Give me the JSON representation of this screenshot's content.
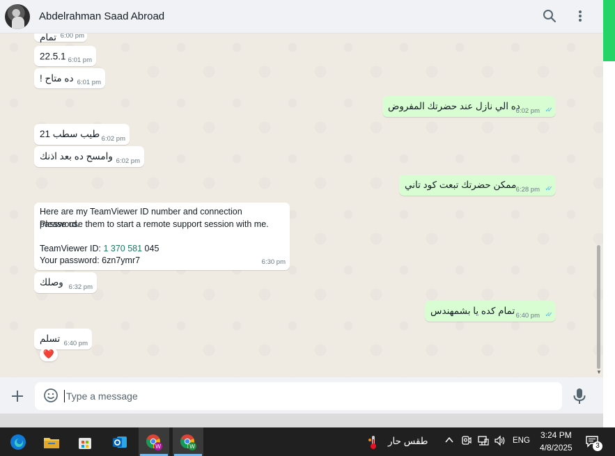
{
  "header": {
    "contact_name": "Abdelrahman Saad Abroad",
    "icons": [
      "search-icon",
      "menu-dots-icon"
    ]
  },
  "messages": [
    {
      "id": "m0",
      "dir": "in",
      "text": "تمام",
      "time": "6:00 pm"
    },
    {
      "id": "m1",
      "dir": "in",
      "text": "22.5.1",
      "time": "6:01 pm"
    },
    {
      "id": "m2",
      "dir": "in",
      "text": "ده متاح !",
      "time": "6:01 pm"
    },
    {
      "id": "m3",
      "dir": "out",
      "text": "ده الي نازل عند حضرتك المفروض",
      "time": "6:02 pm"
    },
    {
      "id": "m4",
      "dir": "in",
      "text": "طيب سطب 21",
      "time": "6:02 pm"
    },
    {
      "id": "m5",
      "dir": "in",
      "text": "وامسح ده بعد اذنك",
      "time": "6:02 pm"
    },
    {
      "id": "m6",
      "dir": "out",
      "text": "ممكن حضرتك تبعت كود تاني",
      "time": "6:28 pm"
    },
    {
      "id": "m8",
      "dir": "in",
      "text": "وصلك",
      "time": "6:32 pm"
    },
    {
      "id": "m9",
      "dir": "out",
      "text": "تمام كده يا بشمهندس",
      "time": "6:40 pm"
    },
    {
      "id": "m10",
      "dir": "in",
      "text": "تسلم",
      "time": "6:40 pm",
      "reaction": "❤️"
    }
  ],
  "teamviewer_msg": {
    "line1": "Here are my TeamViewer ID number and connection password.",
    "line2": "Please use them to start a remote support session with me.",
    "id_label": "TeamViewer ID: ",
    "id_value": "1 370 581",
    "id_suffix": " 045",
    "password_line": "Your password: 6zn7ymr7",
    "time": "6:30 pm"
  },
  "composer": {
    "placeholder": "Type a message"
  },
  "taskbar": {
    "apps": [
      "edge-icon",
      "file-explorer-icon",
      "store-icon",
      "outlook-icon",
      "chrome-profile-icon",
      "chrome-profile-2-icon"
    ],
    "weather": "طقس حار",
    "language": "ENG",
    "time": "3:24 PM",
    "date": "4/8/2025",
    "notification_count": "3"
  },
  "colors": {
    "accent_green": "#25d366",
    "outgoing_bubble": "#d9fdd3",
    "read_ticks": "#53bdeb"
  }
}
